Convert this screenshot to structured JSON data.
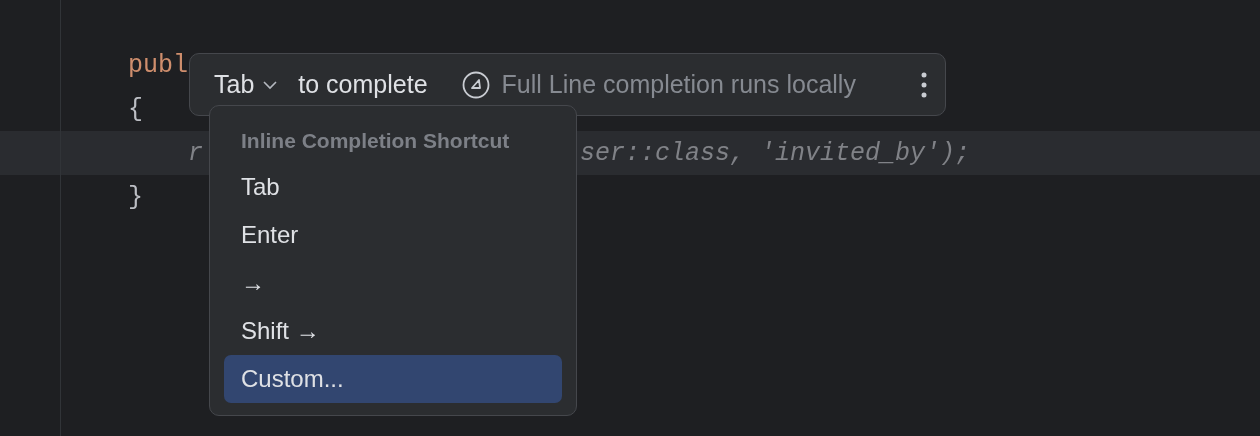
{
  "editor": {
    "lines": [
      {
        "current": false,
        "segments": [
          {
            "text": "publ",
            "kind": "keyword"
          }
        ]
      },
      {
        "current": false,
        "segments": [
          {
            "text": "{",
            "kind": "plain"
          }
        ]
      },
      {
        "current": true,
        "segments": [
          {
            "text": "    r",
            "kind": "hint"
          },
          {
            "text": "ser::class, 'invited_by');",
            "kind": "hint"
          }
        ]
      },
      {
        "current": false,
        "segments": [
          {
            "text": "}",
            "kind": "plain"
          }
        ]
      }
    ]
  },
  "completion_bar": {
    "shortcut": "Tab",
    "suffix": "to complete",
    "info": "Full Line completion runs locally"
  },
  "shortcut_menu": {
    "header": "Inline Completion Shortcut",
    "items": [
      {
        "label": "Tab",
        "selected": false
      },
      {
        "label": "Enter",
        "selected": false
      },
      {
        "label": "→",
        "selected": false
      },
      {
        "label": "Shift →",
        "selected": false
      },
      {
        "label": "Custom...",
        "selected": true
      }
    ]
  }
}
